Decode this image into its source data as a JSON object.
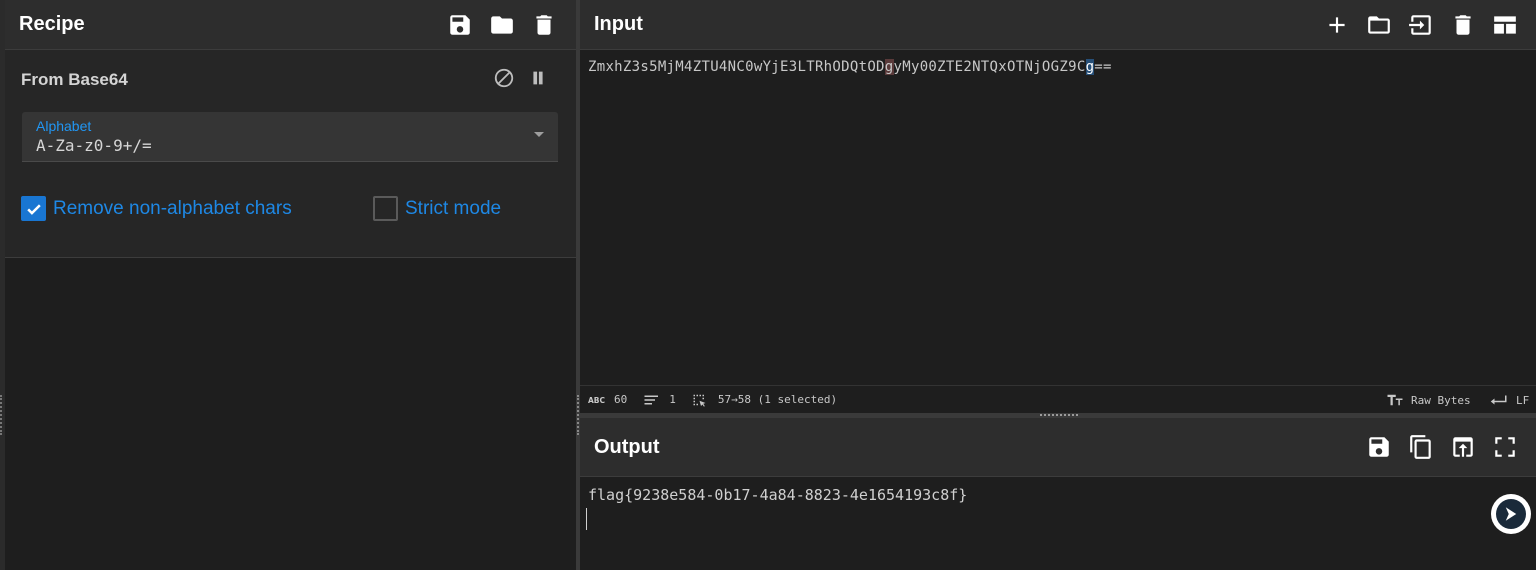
{
  "recipe": {
    "title": "Recipe",
    "toolbar_icons": [
      "save-icon",
      "folder-icon",
      "trash-icon"
    ],
    "operation": {
      "title": "From Base64",
      "controls": [
        "disable-icon",
        "pause-icon"
      ],
      "alphabet_label": "Alphabet",
      "alphabet_value": "A-Za-z0-9+/=",
      "remove_non_alphabet_label": "Remove non-alphabet chars",
      "remove_non_alphabet_checked": true,
      "strict_mode_label": "Strict mode",
      "strict_mode_checked": false
    }
  },
  "input": {
    "title": "Input",
    "toolbar_icons": [
      "plus-icon",
      "folder-icon",
      "import-icon",
      "trash-icon",
      "layout-icon"
    ],
    "text_before": "ZmxhZ3s5MjM4ZTU4NC0wYjE3LTRhODQtOD",
    "text_hl1": "g",
    "text_mid": "yMy00ZTE2NTQxOTNjOGZ9C",
    "text_hl2": "g",
    "text_after": "==",
    "status": {
      "chars": "60",
      "lines": "1",
      "selection": "57→58 (1 selected)",
      "encoding": "Raw Bytes",
      "eol": "LF"
    }
  },
  "output": {
    "title": "Output",
    "toolbar_icons": [
      "save-icon",
      "copy-icon",
      "replace-input-icon",
      "fullscreen-icon"
    ],
    "text": "flag{9238e584-0b17-4a84-8823-4e1654193c8f}"
  },
  "colors": {
    "accent": "#1e88e5",
    "checkbox": "#1976d2",
    "background": "#1e1e1e",
    "header": "#2d2d2d"
  }
}
